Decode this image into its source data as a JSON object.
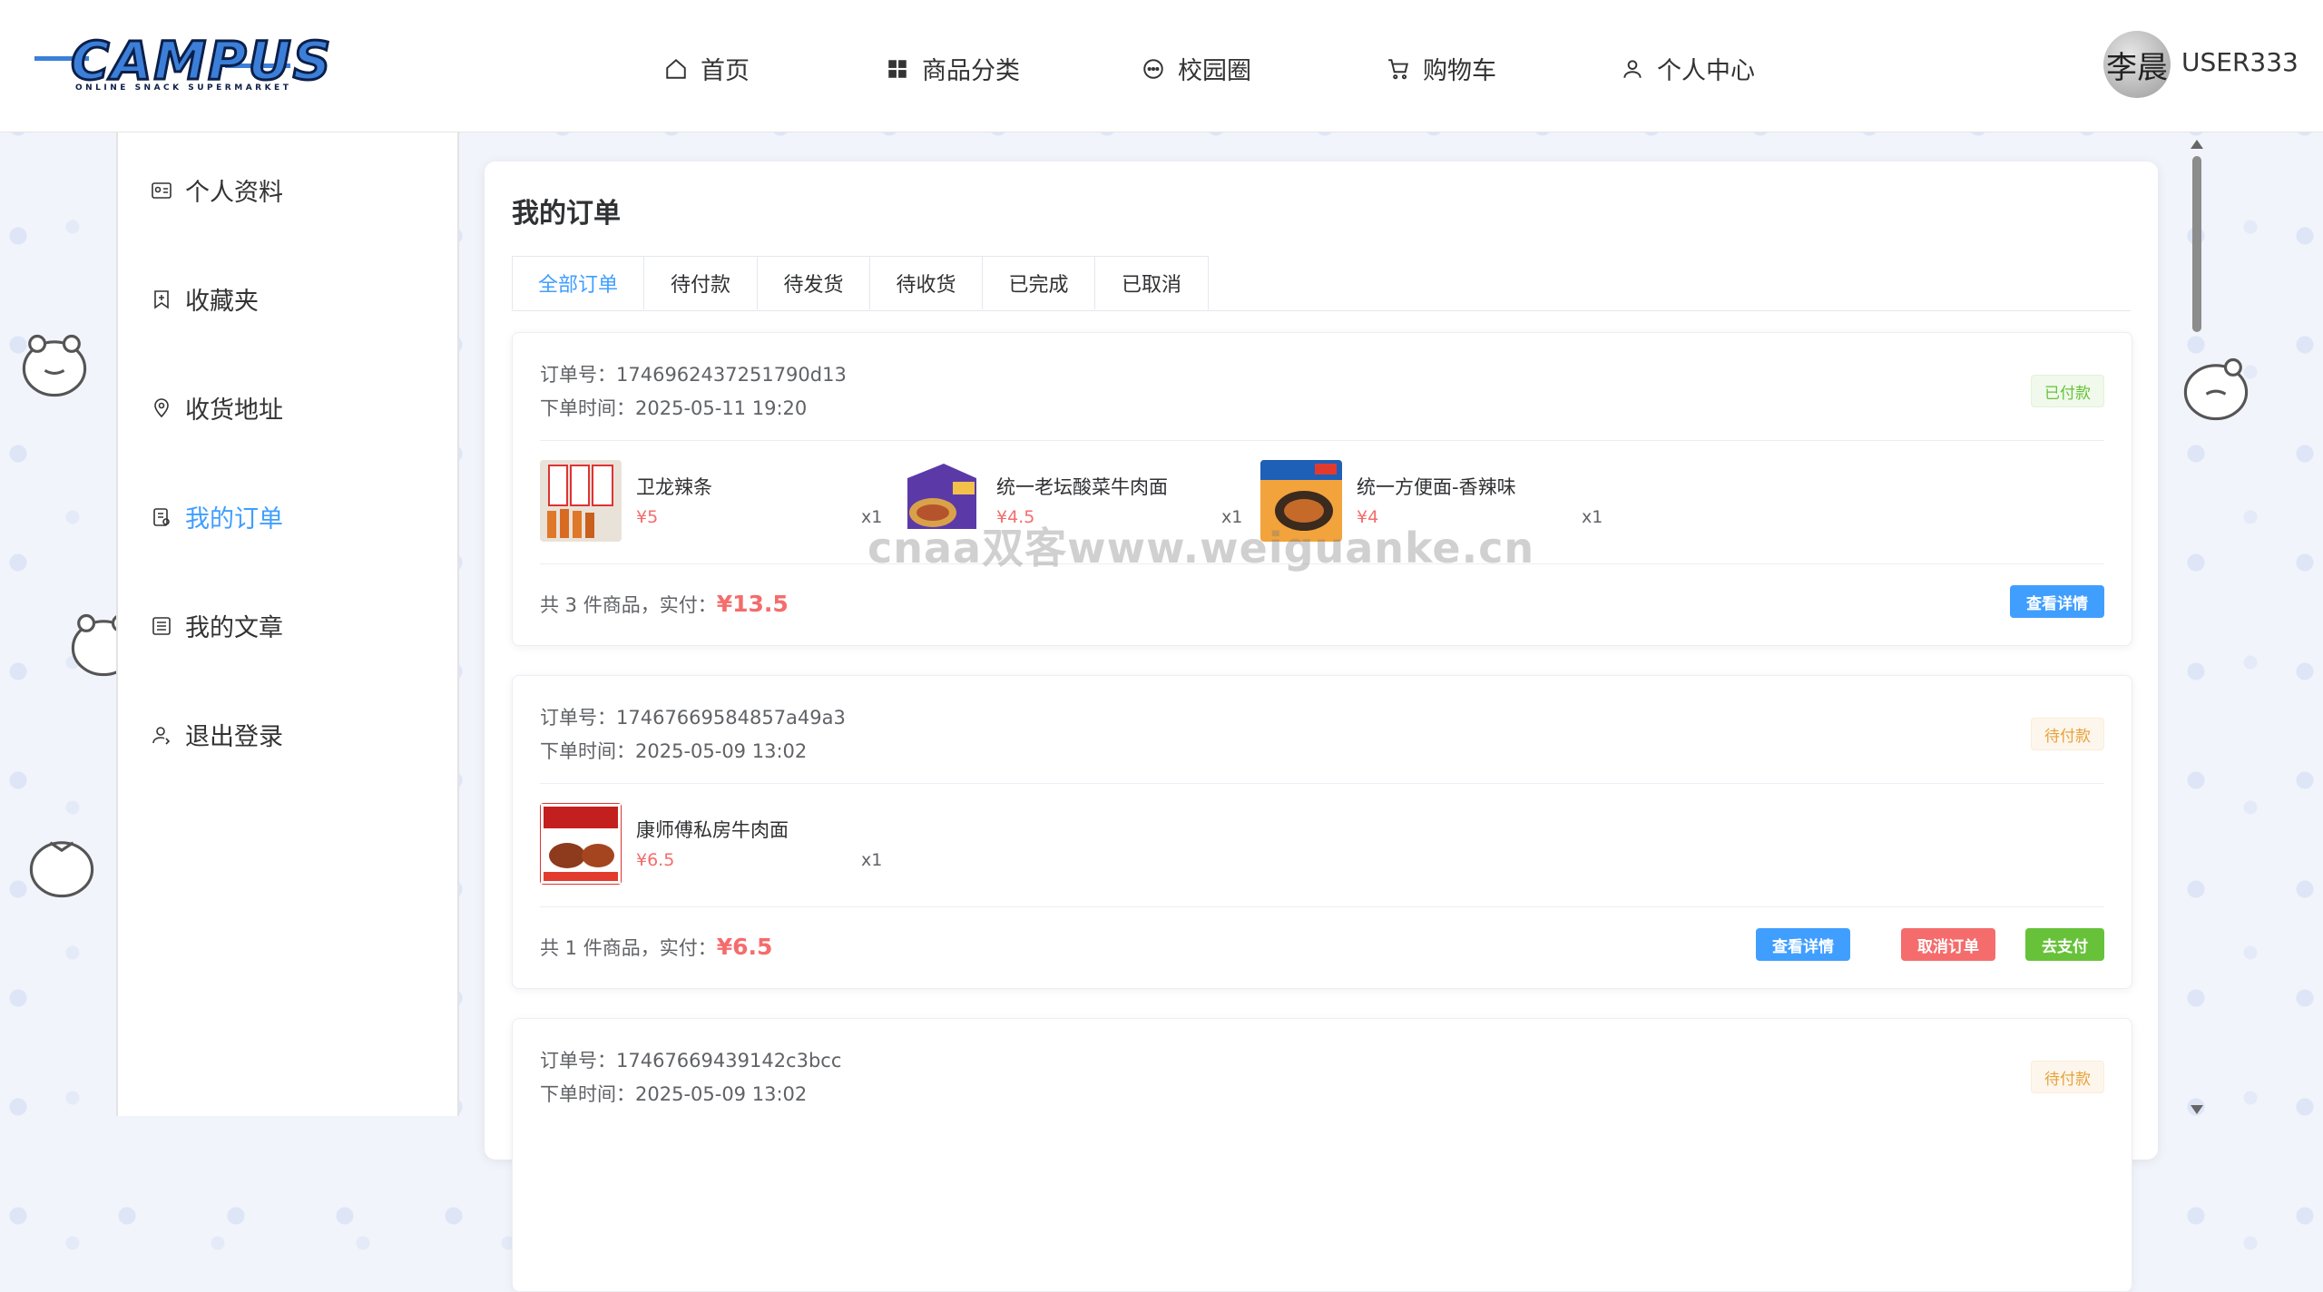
{
  "header": {
    "logo": {
      "text": "CAMPUS",
      "subtitle": "ONLINE SNACK SUPERMARKET"
    },
    "nav": [
      {
        "label": "首页",
        "icon": "home-icon"
      },
      {
        "label": "商品分类",
        "icon": "grid-icon"
      },
      {
        "label": "校园圈",
        "icon": "chat-icon"
      },
      {
        "label": "购物车",
        "icon": "cart-icon"
      },
      {
        "label": "个人中心",
        "icon": "user-icon"
      }
    ],
    "user": {
      "avatar_text": "李晨",
      "name": "USER333"
    }
  },
  "sidebar": {
    "items": [
      {
        "label": "个人资料",
        "icon": "id-card-icon"
      },
      {
        "label": "收藏夹",
        "icon": "bookmark-icon"
      },
      {
        "label": "收货地址",
        "icon": "location-icon"
      },
      {
        "label": "我的订单",
        "icon": "order-icon",
        "active": true
      },
      {
        "label": "我的文章",
        "icon": "article-icon"
      },
      {
        "label": "退出登录",
        "icon": "logout-icon"
      }
    ]
  },
  "main": {
    "title": "我的订单",
    "tabs": [
      "全部订单",
      "待付款",
      "待发货",
      "待收货",
      "已完成",
      "已取消"
    ],
    "active_tab": "全部订单",
    "orders": [
      {
        "order_no": "订单号：1746962437251790d13",
        "time": "下单时间：2025-05-11 19:20",
        "status": "已付款",
        "products": [
          {
            "name": "卫龙辣条",
            "price": "¥5",
            "qty": "x1"
          },
          {
            "name": "统一老坛酸菜牛肉面",
            "price": "¥4.5",
            "qty": "x1"
          },
          {
            "name": "统一方便面-香辣味",
            "price": "¥4",
            "qty": "x1"
          }
        ],
        "summary_prefix": "共 3 件商品，实付：",
        "total": "¥13.5",
        "buttons": [
          "查看详情"
        ]
      },
      {
        "order_no": "订单号：17467669584857a49a3",
        "time": "下单时间：2025-05-09 13:02",
        "status": "待付款",
        "products": [
          {
            "name": "康师傅私房牛肉面",
            "price": "¥6.5",
            "qty": "x1"
          }
        ],
        "summary_prefix": "共 1 件商品，实付：",
        "total": "¥6.5",
        "buttons": [
          "查看详情",
          "取消订单",
          "去支付"
        ]
      },
      {
        "order_no": "订单号：17467669439142c3bcc",
        "time": "下单时间：2025-05-09 13:02",
        "status": "待付款"
      }
    ]
  },
  "watermark": "cnaa双客www.weiguanke.cn",
  "colors": {
    "accent": "#409eff",
    "price": "#f56c6c",
    "success": "#67c23a",
    "warning": "#e6a23c"
  }
}
